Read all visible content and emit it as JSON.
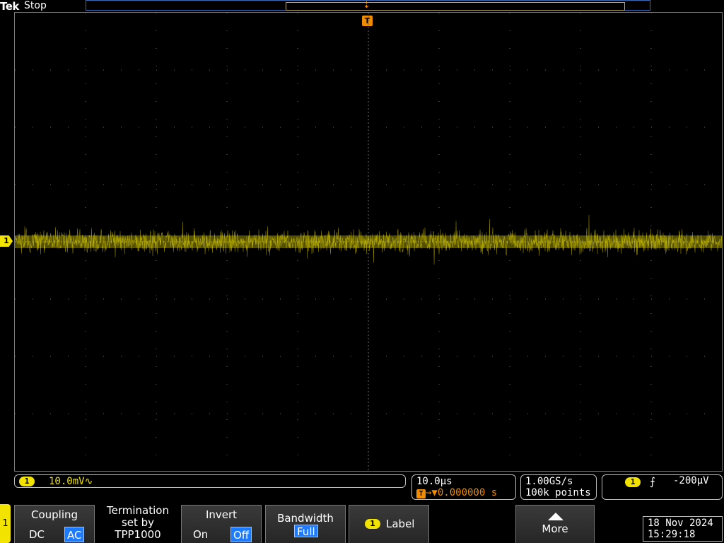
{
  "header": {
    "logo": "Tek",
    "run_state": "Stop",
    "trigger_marker": "T"
  },
  "colors": {
    "ch1": "#f2e400",
    "trigger": "#f08c00",
    "selected": "#1e7bff",
    "grid": "#6a6a6a"
  },
  "channel": {
    "number": "1",
    "scale": "10.0mV",
    "coupling_symbol": "∿"
  },
  "horizontal": {
    "scale": "10.0µs",
    "trigger_position": "0.000000 s",
    "trigger_icon": "T"
  },
  "acquisition": {
    "sample_rate": "1.00GS/s",
    "record_length": "100k points"
  },
  "trigger": {
    "source": "1",
    "slope_icon": "rising-edge-icon",
    "slope_glyph": "⨍",
    "level": "-200µV"
  },
  "menu": {
    "channel_tab": "1",
    "coupling": {
      "title": "Coupling",
      "options": [
        "DC",
        "AC"
      ],
      "selected": "AC"
    },
    "termination": {
      "line1": "Termination",
      "line2": "set by",
      "line3": "TPP1000"
    },
    "invert": {
      "title": "Invert",
      "options": [
        "On",
        "Off"
      ],
      "selected": "Off"
    },
    "bandwidth": {
      "title": "Bandwidth",
      "value": "Full"
    },
    "label": {
      "badge": "1",
      "text": "Label"
    },
    "more": {
      "text": "More",
      "icon": "up-arrow-icon"
    }
  },
  "datetime": {
    "date": "18 Nov 2024",
    "time": "15:29:18"
  }
}
